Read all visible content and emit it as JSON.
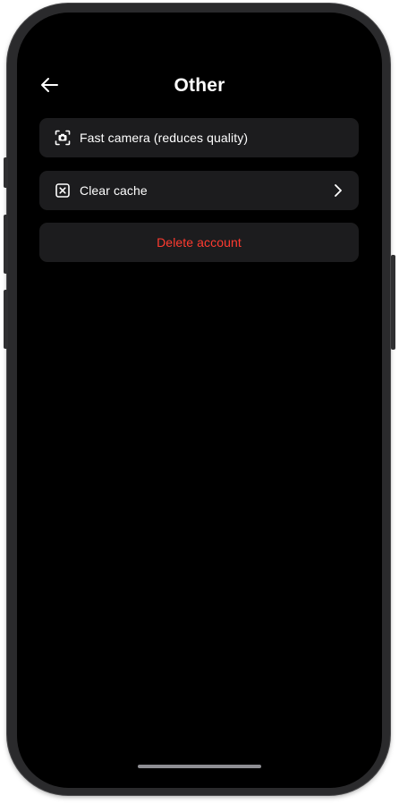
{
  "header": {
    "title": "Other",
    "back_icon": "arrow-left-icon"
  },
  "settings": {
    "items": [
      {
        "label": "Fast camera (reduces quality)",
        "icon": "camera-focus-icon"
      },
      {
        "label": "Clear cache",
        "icon": "close-box-icon",
        "trailing_icon": "chevron-right-icon"
      }
    ],
    "delete_label": "Delete account"
  },
  "colors": {
    "background": "#000000",
    "row_background": "#1c1c1e",
    "text": "#ffffff",
    "danger": "#ff3b30"
  }
}
